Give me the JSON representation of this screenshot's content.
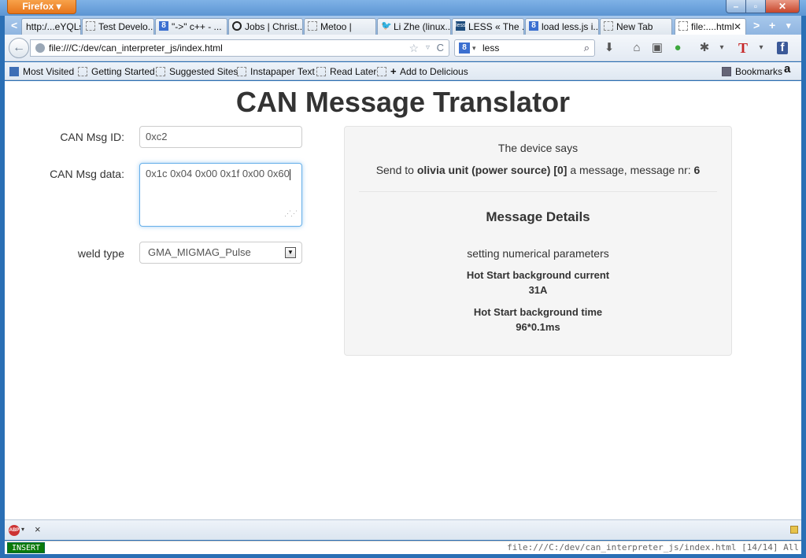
{
  "window": {
    "app_button": "Firefox ▾",
    "min": "–",
    "max": "▫",
    "close": "✕"
  },
  "tabs": [
    {
      "label": "http:/...eYQLs",
      "icon": "none"
    },
    {
      "label": "Test Develo...",
      "icon": "dashed"
    },
    {
      "label": "\"->\" c++ - ...",
      "icon": "google"
    },
    {
      "label": "Jobs | Christ...",
      "icon": "github"
    },
    {
      "label": "Metoo |",
      "icon": "dashed"
    },
    {
      "label": "Li Zhe (linux...",
      "icon": "twitter"
    },
    {
      "label": "LESS « The ...",
      "icon": "less"
    },
    {
      "label": "load less.js i...",
      "icon": "google"
    },
    {
      "label": "New Tab",
      "icon": "dashed"
    },
    {
      "label": "file:....html",
      "icon": "dashed",
      "active": true
    }
  ],
  "tab_nav": {
    "left": "<",
    "right": ">",
    "new": "+",
    "list": "▾"
  },
  "nav": {
    "back": "←",
    "url": "file:///C:/dev/can_interpreter_js/index.html",
    "star": "☆",
    "drop": "▿",
    "reload": "C",
    "search_engine": "8",
    "search_text": "less",
    "search_icon": "⌕"
  },
  "toolbar_icons": {
    "download": "⬇",
    "home": "⌂",
    "screenshot": "▣",
    "addon_green": "●",
    "bug": "✱",
    "dropdown": "▾",
    "t_icon": "T",
    "facebook": "f"
  },
  "bookmarks": {
    "items": [
      "Most Visited",
      "Getting Started",
      "Suggested Sites",
      "Instapaper Text",
      "Read Later",
      "Add to Delicious"
    ],
    "right_label": "Bookmarks",
    "amazon": "a"
  },
  "page": {
    "title": "CAN Message Translator",
    "form": {
      "id_label": "CAN Msg ID:",
      "id_value": "0xc2",
      "data_label": "CAN Msg data:",
      "data_value": "0x1c 0x04 0x00 0x1f 0x00 0x60",
      "weld_label": "weld type",
      "weld_value": "GMA_MIGMAG_Pulse"
    },
    "result": {
      "intro": "The device says",
      "send_prefix": "Send to ",
      "unit": "olivia unit (power source) [0]",
      "send_middle": " a message, message nr: ",
      "message_nr": "6",
      "details_heading": "Message Details",
      "description": "setting numerical parameters",
      "param1_name": "Hot Start background current",
      "param1_value": "31A",
      "param2_name": "Hot Start background time",
      "param2_value": "96*0.1ms"
    }
  },
  "addon_bar": {
    "abp": "ABP",
    "drop": "▾",
    "close": "×"
  },
  "status": {
    "mode": "INSERT",
    "text": "file:///C:/dev/can_interpreter_js/index.html [14/14] All"
  }
}
